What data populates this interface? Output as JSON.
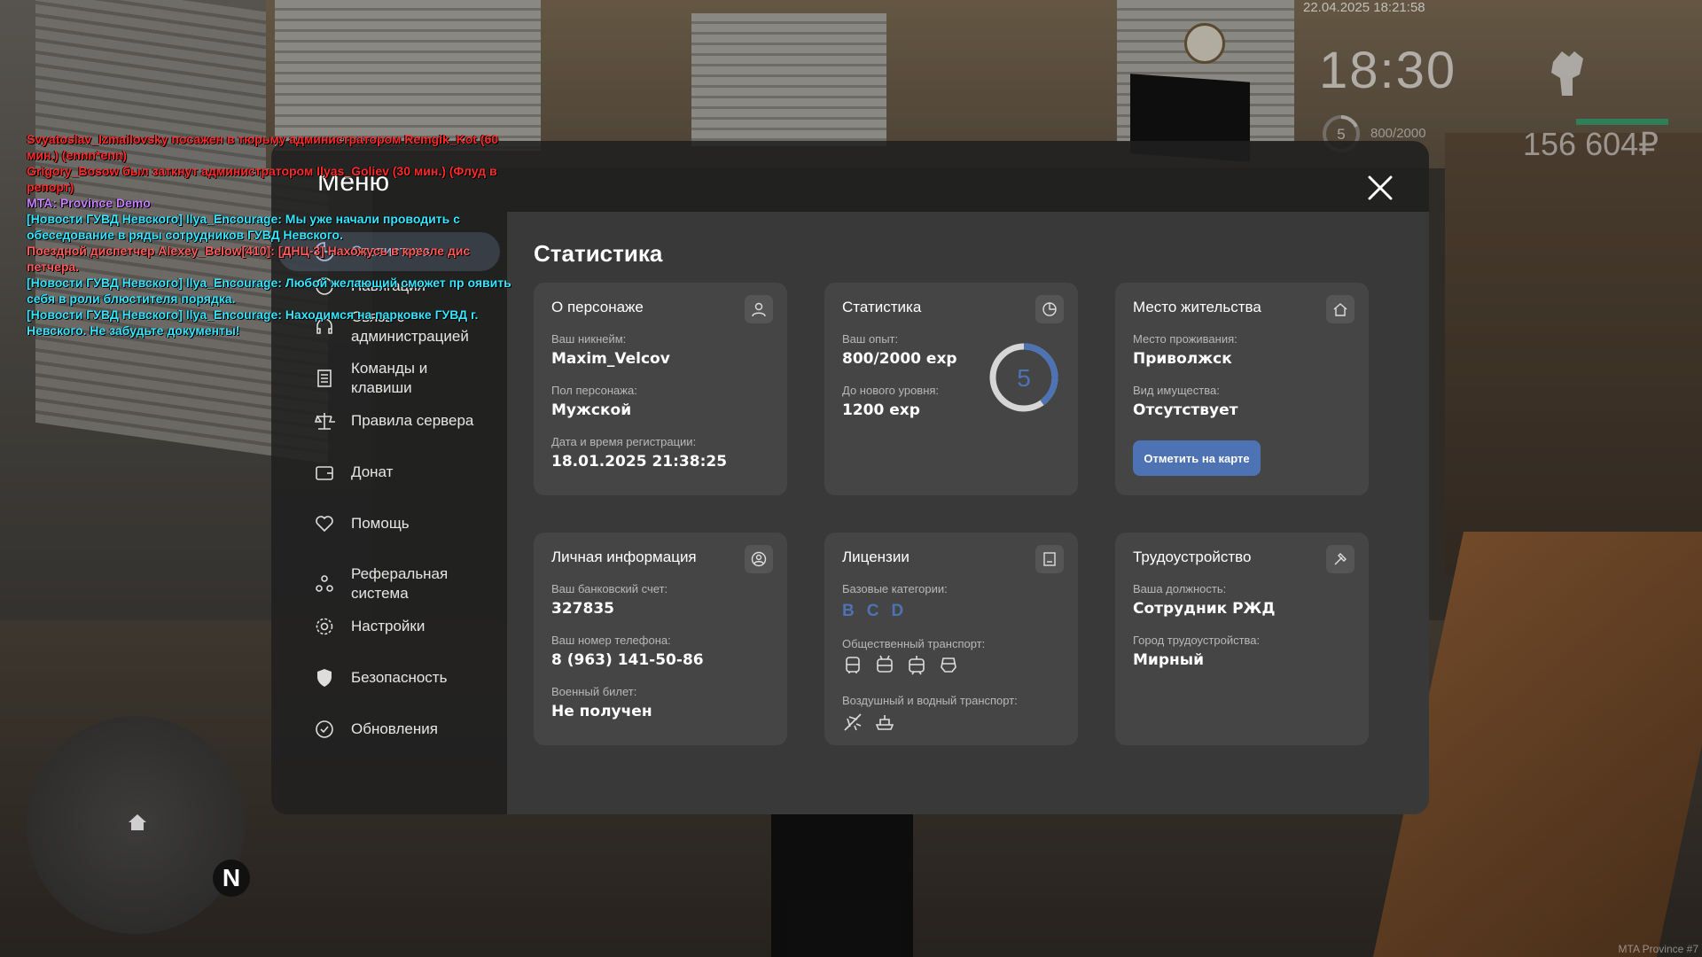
{
  "hud": {
    "datetime": "22.04.2025 18:21:58",
    "time": "18:30",
    "level": "5",
    "exp": "800/2000",
    "money": "156 604₽"
  },
  "chat": [
    {
      "text": "Svyatoslav_Izmailovsky посажен в тюрьму администратором Remgik_Kot (60 мин.) (ennn*enn)",
      "color": "#ff2a2a"
    },
    {
      "text": "Grigory_Bosow был заткнут администратором Ilyas_Goliev (30 мин.) (Флуд в репорт)",
      "color": "#ff2a2a"
    },
    {
      "text": "MTA: Province Demo",
      "color": "#c77dff"
    },
    {
      "text": "[Новости ГУВД Невского] Ilya_Encourage: Мы уже начали проводить с обеседование в ряды сотрудников ГУВД Невского.",
      "color": "#36e6ff"
    },
    {
      "text": "Поездной диспетчер Alexey_Below[410]: [ДНЦ-3] Нахожусь в кресле дис петчера.",
      "color": "#ff5a5a"
    },
    {
      "text": "[Новости ГУВД Невского] Ilya_Encourage: Любой желающий сможет пр оявить себя в роли блюстителя порядка.",
      "color": "#36e6ff"
    },
    {
      "text": "[Новости ГУВД Невского] Ilya_Encourage: Находимся на парковке ГУВД г. Невского. Не забудьте документы!",
      "color": "#36e6ff"
    }
  ],
  "menu": {
    "title": "Меню",
    "nav": [
      {
        "label": "Статистика"
      },
      {
        "label": "Навигация"
      },
      {
        "label": "Связь с администрацией"
      },
      {
        "label": "Команды и клавиши"
      },
      {
        "label": "Правила сервера"
      },
      {
        "label": "Донат"
      },
      {
        "label": "Помощь"
      },
      {
        "label": "Реферальная система"
      },
      {
        "label": "Настройки"
      },
      {
        "label": "Безопасность"
      },
      {
        "label": "Обновления"
      }
    ]
  },
  "content": {
    "title": "Статистика",
    "character": {
      "head": "О персонаже",
      "nick_label": "Ваш никнейм:",
      "nick": "Maxim_Velcov",
      "gender_label": "Пол персонажа:",
      "gender": "Мужской",
      "reg_label": "Дата и время регистрации:",
      "reg": "18.01.2025 21:38:25"
    },
    "stats": {
      "head": "Статистика",
      "exp_label": "Ваш опыт:",
      "exp": "800/2000 exp",
      "next_label": "До нового уровня:",
      "next": "1200 exp",
      "level": "5",
      "progress": 0.4
    },
    "residence": {
      "head": "Место жительства",
      "place_label": "Место проживания:",
      "place": "Приволжск",
      "property_label": "Вид имущества:",
      "property": "Отсутствует",
      "button": "Отметить на карте"
    },
    "personal": {
      "head": "Личная информация",
      "bank_label": "Ваш банковский счет:",
      "bank": "327835",
      "phone_label": "Ваш номер телефона:",
      "phone": "8 (963) 141-50-86",
      "military_label": "Военный билет:",
      "military": "Не получен"
    },
    "licenses": {
      "head": "Лицензии",
      "base_label": "Базовые категории:",
      "categories": [
        "B",
        "C",
        "D"
      ],
      "public_label": "Общественный транспорт:",
      "air_label": "Воздушный и водный транспорт:"
    },
    "job": {
      "head": "Трудоустройство",
      "position_label": "Ваша должность:",
      "position": "Сотрудник РЖД",
      "city_label": "Город трудоустройства:",
      "city": "Мирный"
    }
  },
  "footer": {
    "watermark": "MTA Province #7"
  },
  "colors": {
    "accent": "#4d73b5",
    "panel": "#393939",
    "card": "#454545",
    "active_nav": "#a7b8d6"
  }
}
